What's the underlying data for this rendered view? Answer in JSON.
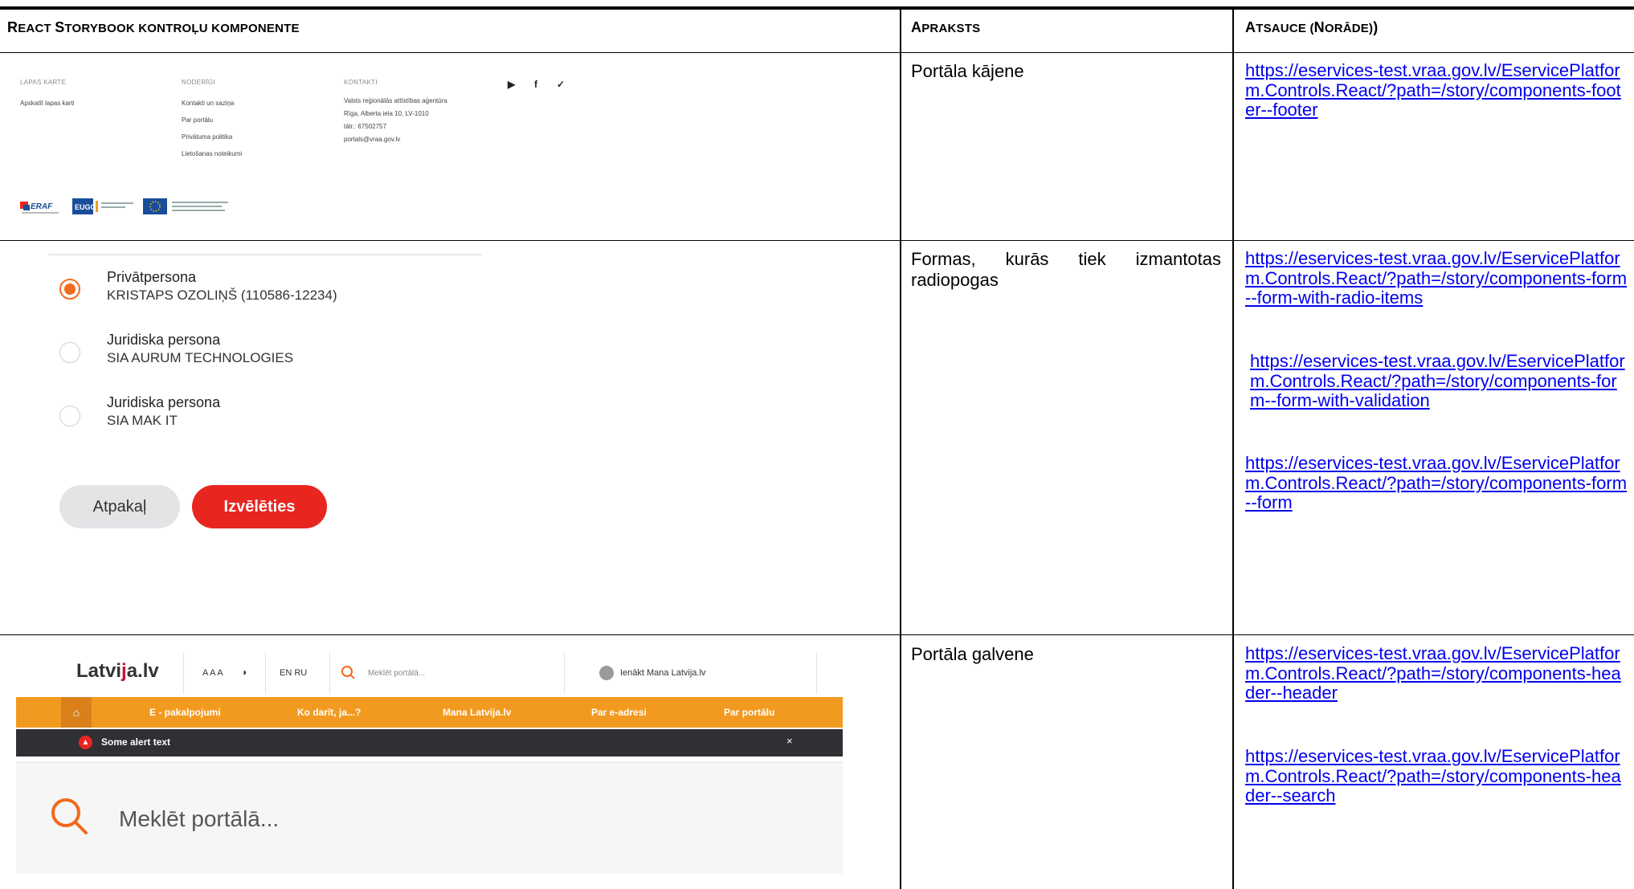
{
  "table": {
    "headers": {
      "component": {
        "first": "R",
        "first_rest": "EACT ",
        "s": "S",
        "s_rest": "TORYBOOK KONTROĻU KOMPONENTE"
      },
      "description": {
        "first": "A",
        "rest": "PRAKSTS"
      },
      "reference": {
        "first": "A",
        "rest": "TSAUCE (",
        "n": "N",
        "n_rest": "ORĀDE)"
      }
    },
    "rows": [
      {
        "description": "Portāla kājene",
        "links": [
          "https://eservices-test.vraa.gov.lv/EservicePlatform.Controls.React/?path=/story/components-footer--footer"
        ]
      },
      {
        "description": "Formas, kurās tiek izmantotas radiopogas",
        "links": [
          "https://eservices-test.vraa.gov.lv/EservicePlatform.Controls.React/?path=/story/components-form--form-with-radio-items",
          "https://eservices-test.vraa.gov.lv/EservicePlatform.Controls.React/?path=/story/components-form--form-with-validation",
          "https://eservices-test.vraa.gov.lv/EservicePlatform.Controls.React/?path=/story/components-form--form"
        ]
      },
      {
        "description": "Portāla galvene",
        "links": [
          "https://eservices-test.vraa.gov.lv/EservicePlatform.Controls.React/?path=/story/components-header--header",
          "https://eservices-test.vraa.gov.lv/EservicePlatform.Controls.React/?path=/story/components-header--search"
        ]
      }
    ]
  },
  "footer_mock": {
    "col1": {
      "heading": "LAPAS KARTE",
      "items": [
        "Apskatīt lapas karti"
      ]
    },
    "col2": {
      "heading": "NODERĪGI",
      "items": [
        "Kontakti un saziņa",
        "Par portālu",
        "Privātuma politika",
        "Lietošanas noteikumi"
      ]
    },
    "col3": {
      "heading": "KONTAKTI",
      "items": [
        "Valsts reģionālās attīstības aģentūra",
        "Rīga, Alberta iela 10, LV-1010",
        "tālr.: 67502757",
        "portals@vraa.gov.lv"
      ]
    },
    "logos": [
      "ERAF",
      "EUGO"
    ]
  },
  "radio_mock": {
    "options": [
      {
        "title": "Privātpersona",
        "sub": "KRISTAPS OZOLIŅŠ (110586-12234)",
        "selected": true
      },
      {
        "title": "Juridiska persona",
        "sub": "SIA AURUM TECHNOLOGIES",
        "selected": false
      },
      {
        "title": "Juridiska persona",
        "sub": "SIA MAK IT",
        "selected": false
      }
    ],
    "back_label": "Atpakaļ",
    "choose_label": "Izvēlēties"
  },
  "header_mock": {
    "logo_left": "Latvi",
    "logo_mid": "j",
    "logo_right": "a.lv",
    "font_size": "A A A",
    "lang": "EN  RU",
    "search_placeholder": "Meklēt portālā...",
    "login": "Ienākt Mana Latvija.lv",
    "nav": [
      "E - pakalpojumi",
      "Ko darīt, ja...?",
      "Mana Latvija.lv",
      "Par e-adresi",
      "Par portālu"
    ],
    "alert_text": "Some alert text",
    "alert_close": "×",
    "big_search": "Meklēt portālā..."
  },
  "colors": {
    "accent_orange": "#f29a1f",
    "alert_bg": "#2f3033",
    "button_red": "#e9251f",
    "radio_orange": "#f26a1b",
    "link": "#0000ee"
  }
}
